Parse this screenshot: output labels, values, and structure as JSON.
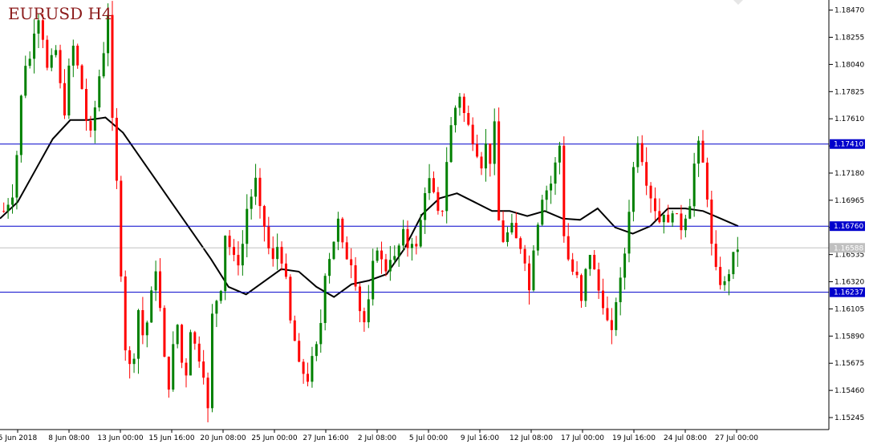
{
  "chart_data": {
    "type": "candlestick",
    "title": "EURUSD H4",
    "symbol": "EURUSD",
    "timeframe": "H4",
    "ylim": [
      1.1515,
      1.1855
    ],
    "y_ticks": [
      "1.18470",
      "1.18255",
      "1.18040",
      "1.17825",
      "1.17610",
      "1.17395",
      "1.17180",
      "1.16965",
      "1.16750",
      "1.16535",
      "1.16320",
      "1.16105",
      "1.15890",
      "1.15675",
      "1.15460",
      "1.15245"
    ],
    "x_ticks": [
      "5 Jun 2018",
      "8 Jun 08:00",
      "13 Jun 00:00",
      "15 Jun 16:00",
      "20 Jun 08:00",
      "25 Jun 00:00",
      "27 Jun 16:00",
      "2 Jul 08:00",
      "5 Jul 00:00",
      "9 Jul 16:00",
      "12 Jul 08:00",
      "17 Jul 00:00",
      "19 Jul 16:00",
      "24 Jul 08:00",
      "27 Jul 00:00"
    ],
    "horizontal_levels": [
      {
        "value": 1.1741,
        "label": "1.17410",
        "color": "#0000cc"
      },
      {
        "value": 1.1676,
        "label": "1.16760",
        "color": "#0000cc"
      },
      {
        "value": 1.16237,
        "label": "1.16237",
        "color": "#0000cc"
      }
    ],
    "current_price": {
      "value": 1.16588,
      "label": "1.16588",
      "color": "#c0c0c0"
    },
    "bull_color": "#008000",
    "bear_color": "#ff0000",
    "ma_color": "#000000",
    "level_color": "#0000cc",
    "grid": false,
    "close_path": [
      [
        0,
        1.1688
      ],
      [
        2,
        1.1702
      ],
      [
        3,
        1.1733
      ],
      [
        4,
        1.1778
      ],
      [
        5,
        1.1805
      ],
      [
        6,
        1.1808
      ],
      [
        7,
        1.1832
      ],
      [
        8,
        1.1842
      ],
      [
        9,
        1.1826
      ],
      [
        10,
        1.18
      ],
      [
        12,
        1.1815
      ],
      [
        13,
        1.1787
      ],
      [
        14,
        1.1767
      ],
      [
        15,
        1.18
      ],
      [
        16,
        1.1818
      ],
      [
        17,
        1.1802
      ],
      [
        18,
        1.1785
      ],
      [
        19,
        1.176
      ],
      [
        20,
        1.1748
      ],
      [
        21,
        1.177
      ],
      [
        22,
        1.1795
      ],
      [
        23,
        1.1815
      ],
      [
        24,
        1.1845
      ],
      [
        25,
        1.1758
      ],
      [
        26,
        1.171
      ],
      [
        27,
        1.164
      ],
      [
        28,
        1.158
      ],
      [
        29,
        1.1565
      ],
      [
        30,
        1.1575
      ],
      [
        31,
        1.161
      ],
      [
        32,
        1.159
      ],
      [
        33,
        1.16
      ],
      [
        34,
        1.1622
      ],
      [
        35,
        1.1643
      ],
      [
        36,
        1.161
      ],
      [
        37,
        1.157
      ],
      [
        38,
        1.155
      ],
      [
        39,
        1.158
      ],
      [
        40,
        1.1598
      ],
      [
        41,
        1.1568
      ],
      [
        42,
        1.156
      ],
      [
        43,
        1.1595
      ],
      [
        44,
        1.1582
      ],
      [
        45,
        1.1572
      ],
      [
        46,
        1.156
      ],
      [
        47,
        1.153
      ],
      [
        48,
        1.1605
      ],
      [
        49,
        1.1618
      ],
      [
        50,
        1.1628
      ],
      [
        51,
        1.167
      ],
      [
        52,
        1.166
      ],
      [
        53,
        1.165
      ],
      [
        54,
        1.1648
      ],
      [
        55,
        1.1662
      ],
      [
        56,
        1.169
      ],
      [
        57,
        1.17
      ],
      [
        58,
        1.1712
      ],
      [
        59,
        1.1688
      ],
      [
        60,
        1.1676
      ],
      [
        61,
        1.1658
      ],
      [
        62,
        1.1648
      ],
      [
        63,
        1.166
      ],
      [
        64,
        1.165
      ],
      [
        65,
        1.1632
      ],
      [
        66,
        1.16
      ],
      [
        67,
        1.1585
      ],
      [
        68,
        1.1565
      ],
      [
        69,
        1.156
      ],
      [
        70,
        1.1555
      ],
      [
        71,
        1.157
      ],
      [
        72,
        1.158
      ],
      [
        73,
        1.16
      ],
      [
        74,
        1.164
      ],
      [
        75,
        1.1652
      ],
      [
        76,
        1.1665
      ],
      [
        77,
        1.168
      ],
      [
        78,
        1.166
      ],
      [
        79,
        1.1652
      ],
      [
        80,
        1.1648
      ],
      [
        81,
        1.1632
      ],
      [
        82,
        1.161
      ],
      [
        83,
        1.16
      ],
      [
        84,
        1.1615
      ],
      [
        85,
        1.1645
      ],
      [
        86,
        1.166
      ],
      [
        87,
        1.1648
      ],
      [
        88,
        1.1642
      ],
      [
        89,
        1.1652
      ],
      [
        90,
        1.165
      ],
      [
        91,
        1.166
      ],
      [
        92,
        1.167
      ],
      [
        93,
        1.166
      ],
      [
        94,
        1.1665
      ],
      [
        95,
        1.1658
      ],
      [
        96,
        1.168
      ],
      [
        97,
        1.1705
      ],
      [
        98,
        1.1712
      ],
      [
        99,
        1.17
      ],
      [
        100,
        1.1685
      ],
      [
        101,
        1.169
      ],
      [
        102,
        1.1728
      ],
      [
        103,
        1.1755
      ],
      [
        104,
        1.177
      ],
      [
        105,
        1.178
      ],
      [
        106,
        1.1765
      ],
      [
        107,
        1.1755
      ],
      [
        108,
        1.1745
      ],
      [
        109,
        1.1735
      ],
      [
        110,
        1.1725
      ],
      [
        111,
        1.174
      ],
      [
        112,
        1.1728
      ],
      [
        113,
        1.1755
      ],
      [
        114,
        1.168
      ],
      [
        115,
        1.1665
      ],
      [
        116,
        1.167
      ],
      [
        117,
        1.1675
      ],
      [
        118,
        1.1665
      ],
      [
        119,
        1.166
      ],
      [
        120,
        1.165
      ],
      [
        121,
        1.1625
      ],
      [
        122,
        1.166
      ],
      [
        123,
        1.168
      ],
      [
        124,
        1.17
      ],
      [
        125,
        1.1705
      ],
      [
        126,
        1.171
      ],
      [
        127,
        1.1725
      ],
      [
        128,
        1.174
      ],
      [
        129,
        1.167
      ],
      [
        130,
        1.165
      ],
      [
        131,
        1.164
      ],
      [
        132,
        1.1635
      ],
      [
        133,
        1.1615
      ],
      [
        134,
        1.164
      ],
      [
        135,
        1.1655
      ],
      [
        136,
        1.164
      ],
      [
        137,
        1.1625
      ],
      [
        138,
        1.1615
      ],
      [
        139,
        1.16
      ],
      [
        140,
        1.159
      ],
      [
        141,
        1.1618
      ],
      [
        142,
        1.1632
      ],
      [
        143,
        1.1655
      ],
      [
        144,
        1.169
      ],
      [
        145,
        1.1722
      ],
      [
        146,
        1.1745
      ],
      [
        147,
        1.173
      ],
      [
        148,
        1.1712
      ],
      [
        149,
        1.17
      ],
      [
        150,
        1.169
      ],
      [
        151,
        1.168
      ],
      [
        152,
        1.1688
      ],
      [
        153,
        1.1676
      ],
      [
        154,
        1.169
      ],
      [
        155,
        1.1682
      ],
      [
        156,
        1.1675
      ],
      [
        157,
        1.1685
      ],
      [
        158,
        1.1695
      ],
      [
        159,
        1.1725
      ],
      [
        160,
        1.174
      ],
      [
        161,
        1.1725
      ],
      [
        162,
        1.17
      ],
      [
        163,
        1.166
      ],
      [
        164,
        1.164
      ],
      [
        165,
        1.1632
      ],
      [
        166,
        1.163
      ],
      [
        167,
        1.164
      ],
      [
        168,
        1.1652
      ],
      [
        169,
        1.1659
      ]
    ],
    "ma_path": [
      [
        0,
        1.1682
      ],
      [
        5,
        1.1695
      ],
      [
        10,
        1.172
      ],
      [
        15,
        1.1745
      ],
      [
        20,
        1.176
      ],
      [
        25,
        1.176
      ],
      [
        30,
        1.1762
      ],
      [
        35,
        1.175
      ],
      [
        40,
        1.173
      ],
      [
        45,
        1.171
      ],
      [
        50,
        1.169
      ],
      [
        55,
        1.167
      ],
      [
        60,
        1.165
      ],
      [
        65,
        1.1628
      ],
      [
        70,
        1.1622
      ],
      [
        75,
        1.1632
      ],
      [
        80,
        1.1642
      ],
      [
        85,
        1.164
      ],
      [
        90,
        1.1628
      ],
      [
        95,
        1.162
      ],
      [
        100,
        1.163
      ],
      [
        105,
        1.1633
      ],
      [
        110,
        1.1638
      ],
      [
        115,
        1.1658
      ],
      [
        120,
        1.1685
      ],
      [
        125,
        1.1698
      ],
      [
        130,
        1.1702
      ],
      [
        135,
        1.1695
      ],
      [
        140,
        1.1688
      ],
      [
        145,
        1.1688
      ],
      [
        150,
        1.1684
      ],
      [
        155,
        1.1688
      ],
      [
        160,
        1.1682
      ],
      [
        165,
        1.1681
      ],
      [
        170,
        1.169
      ],
      [
        175,
        1.1675
      ],
      [
        180,
        1.167
      ],
      [
        185,
        1.1676
      ],
      [
        190,
        1.169
      ],
      [
        195,
        1.169
      ],
      [
        200,
        1.1688
      ],
      [
        205,
        1.1682
      ],
      [
        210,
        1.1676
      ]
    ]
  }
}
